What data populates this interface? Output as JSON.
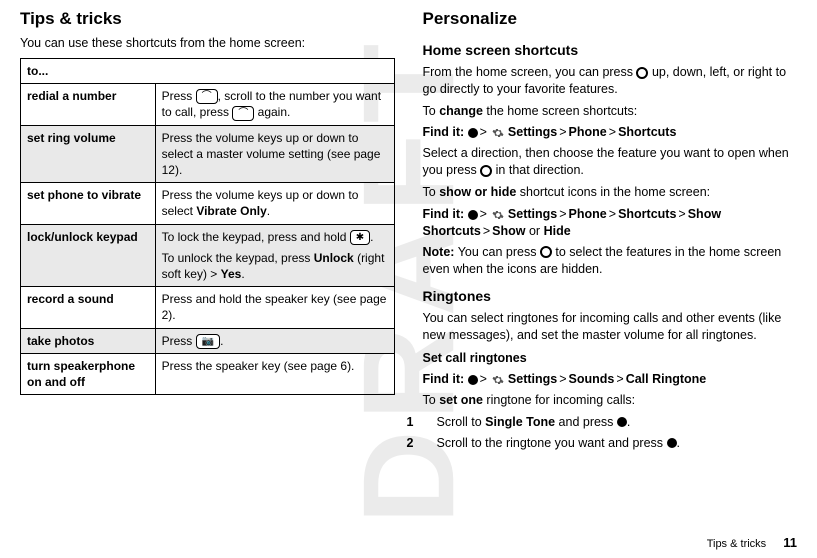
{
  "watermark": "DRAFT",
  "left": {
    "title": "Tips & tricks",
    "intro": "You can use these shortcuts from the home screen:",
    "table": {
      "header": "to...",
      "rows": [
        {
          "label": "redial a number",
          "desc_pre": "Press ",
          "desc_mid": ", scroll to the number you want to call, press ",
          "desc_post": " again."
        },
        {
          "label": "set ring volume",
          "desc": "Press the volume keys up or down to select a master volume setting (see page 12)."
        },
        {
          "label": "set phone to vibrate",
          "desc_pre": "Press the volume keys up or down to select ",
          "vibrate": "Vibrate Only",
          "desc_post": "."
        },
        {
          "label": "lock/unlock keypad",
          "desc_pre": "To lock the keypad, press and hold ",
          "desc_post": ".",
          "desc2_pre": "To unlock the keypad, press ",
          "unlock": "Unlock",
          "desc2_mid": " (right soft key) > ",
          "yes": "Yes",
          "desc2_post": "."
        },
        {
          "label": "record a sound",
          "desc": "Press and hold the speaker key (see page 2)."
        },
        {
          "label": "take photos",
          "desc_pre": "Press ",
          "desc_post": "."
        },
        {
          "label": "turn speakerphone on and off",
          "desc": "Press the speaker key (see page 6)."
        }
      ]
    }
  },
  "right": {
    "title": "Personalize",
    "shortcuts": {
      "heading": "Home screen shortcuts",
      "p1_pre": "From the home screen, you can press ",
      "p1_post": " up, down, left, or right to go directly to your favorite features.",
      "p2_pre": "To ",
      "p2_bold": "change",
      "p2_post": " the home screen shortcuts:",
      "find1": {
        "label": "Find it:",
        "settings": "Settings",
        "phone": "Phone",
        "shortcuts": "Shortcuts"
      },
      "p3_pre": "Select a direction, then choose the feature you want to open when you press ",
      "p3_post": " in that direction.",
      "p4_pre": "To ",
      "p4_bold": "show or hide",
      "p4_post": " shortcut icons in the home screen:",
      "find2": {
        "label": "Find it:",
        "settings": "Settings",
        "phone": "Phone",
        "shortcuts": "Shortcuts",
        "showshortcuts": "Show Shortcuts",
        "show": "Show",
        "or": " or ",
        "hide": "Hide"
      },
      "note_label": "Note:",
      "note_pre": " You can press ",
      "note_post": " to select the features in the home screen even when the icons are hidden."
    },
    "ringtones": {
      "heading": "Ringtones",
      "p1": "You can select ringtones for incoming calls and other events (like new messages), and set the master volume for all ringtones.",
      "sub": "Set call ringtones",
      "find": {
        "label": "Find it:",
        "settings": "Settings",
        "sounds": "Sounds",
        "call": "Call Ringtone"
      },
      "p2_pre": "To ",
      "p2_bold": "set one",
      "p2_post": " ringtone for incoming calls:",
      "step1_pre": "Scroll to ",
      "step1_mid": "Single Tone",
      "step1_post": " and press ",
      "step2_pre": "Scroll to the ringtone you want and press ",
      "step1_num": "1",
      "step2_num": "2"
    }
  },
  "keys": {
    "call": "⌒",
    "star": "✱",
    "camera": "📷"
  },
  "footer": {
    "section": "Tips & tricks",
    "page": "11"
  }
}
